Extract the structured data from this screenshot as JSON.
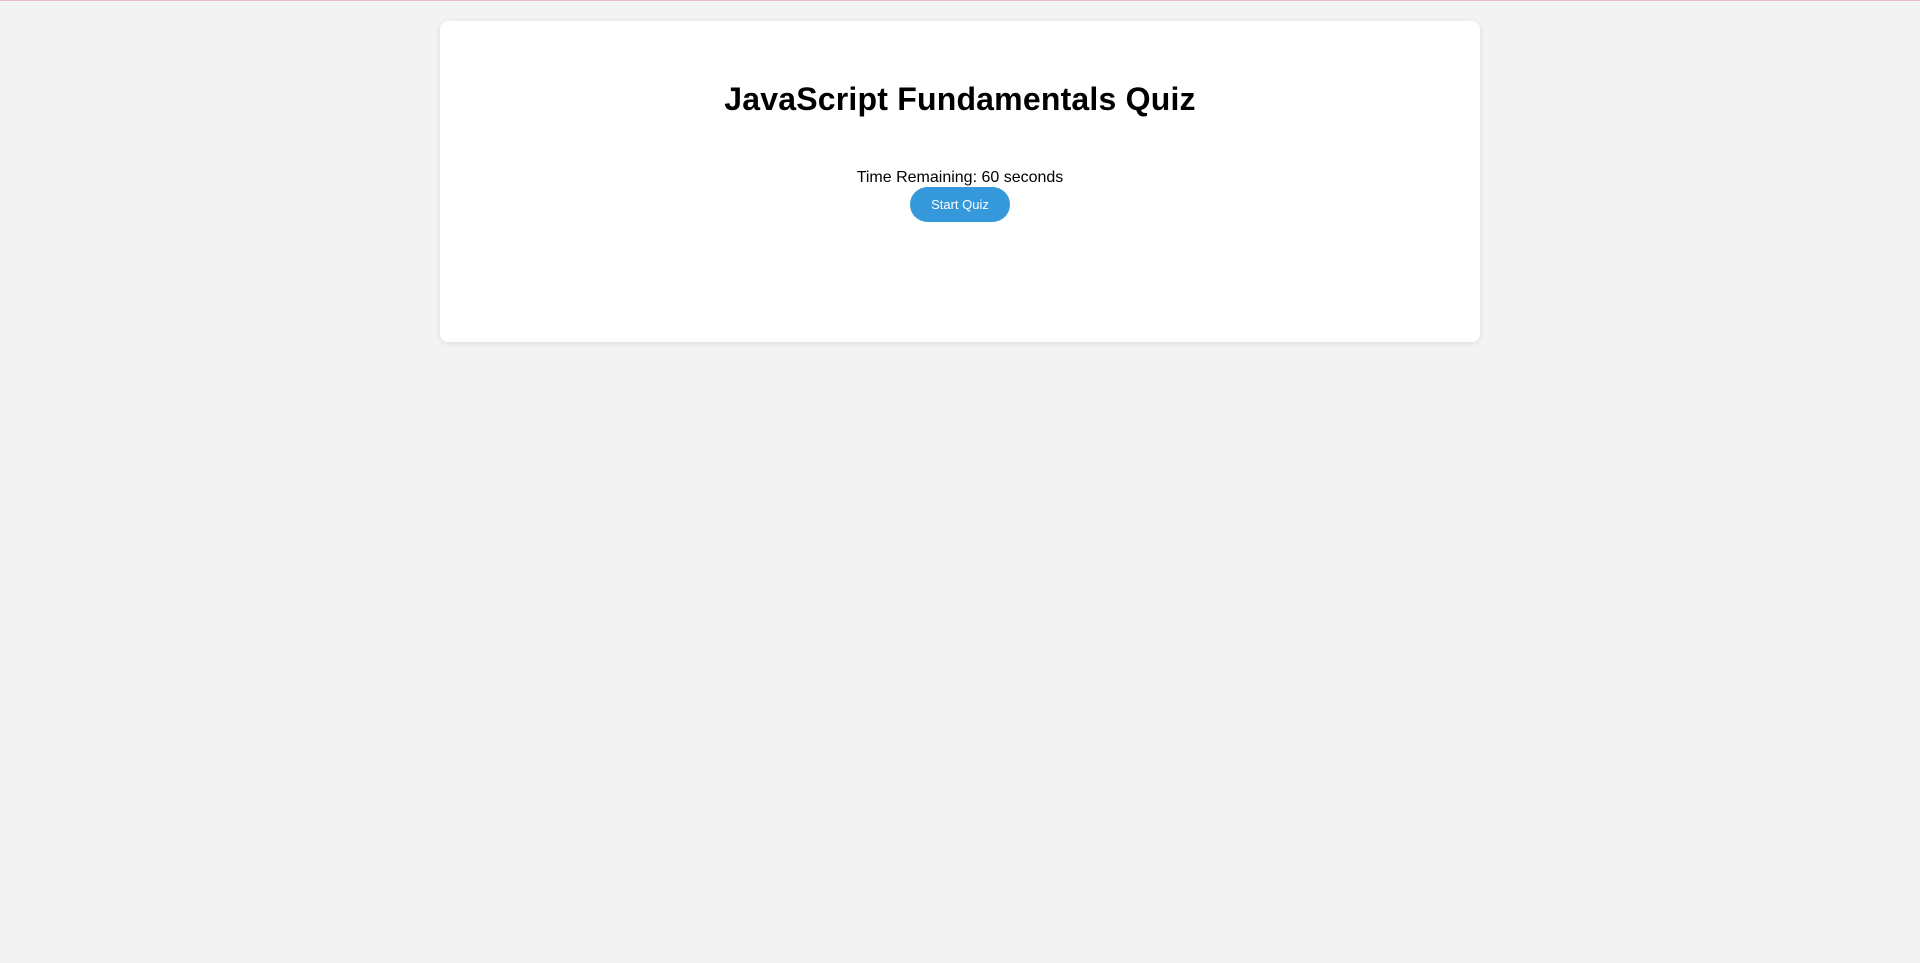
{
  "quiz": {
    "title": "JavaScript Fundamentals Quiz",
    "timer_text": "Time Remaining: 60 seconds",
    "start_button_label": "Start Quiz"
  },
  "colors": {
    "page_background": "#f3f3f3",
    "card_background": "#ffffff",
    "button_background": "#3498db",
    "button_text": "#ffffff",
    "title_text": "#000000"
  }
}
